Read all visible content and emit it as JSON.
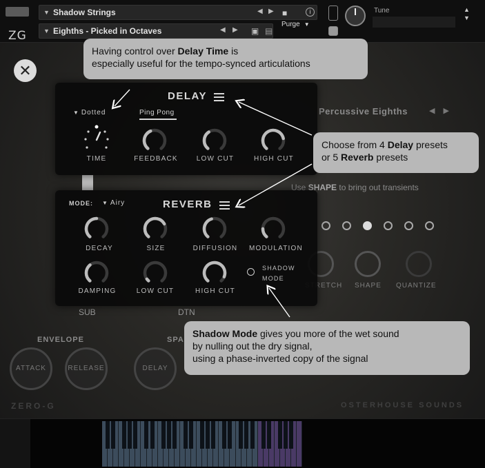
{
  "topbar": {
    "logo": "ZG",
    "preset_name": "Shadow Strings",
    "articulation_name": "Eighths - Picked in Octaves",
    "purge_label": "Purge",
    "tune_label": "Tune"
  },
  "background": {
    "right_panel_title": "Percussive Eighths",
    "shape_hint_pre": "Use",
    "shape_hint_word": "SHAPE",
    "shape_hint_post": "to bring out transients",
    "right_knobs": [
      "STRETCH",
      "SHAPE",
      "QUANTIZE"
    ],
    "sub_label": "SUB",
    "dtn_label": "DTN",
    "envelope_label": "ENVELOPE",
    "space_label": "SPACE",
    "attack_label": "ATTACK",
    "release_label": "RELEASE",
    "delay_label": "DELAY",
    "brand_left": "ZERO-G",
    "brand_right": "OSTERHOUSE SOUNDS"
  },
  "delay": {
    "title": "DELAY",
    "mode_value": "Dotted",
    "ping_pong": "Ping Pong",
    "knobs": [
      {
        "label": "TIME"
      },
      {
        "label": "FEEDBACK",
        "value": 0.42
      },
      {
        "label": "LOW CUT",
        "value": 0.38
      },
      {
        "label": "HIGH CUT",
        "value": 0.78
      }
    ]
  },
  "reverb": {
    "title": "REVERB",
    "mode_label": "MODE:",
    "mode_value": "Airy",
    "knobs_row1": [
      {
        "label": "DECAY",
        "value": 0.5
      },
      {
        "label": "SIZE",
        "value": 0.72
      },
      {
        "label": "DIFFUSION",
        "value": 0.44
      },
      {
        "label": "MODULATION",
        "value": 0.18
      }
    ],
    "knobs_row2": [
      {
        "label": "DAMPING",
        "value": 0.36
      },
      {
        "label": "LOW CUT",
        "value": 0.05
      },
      {
        "label": "HIGH CUT",
        "value": 0.9
      }
    ],
    "shadow_mode": "SHADOW MODE"
  },
  "tooltips": {
    "tip1_line1_pre": "Having control over ",
    "tip1_line1_bold": "Delay Time",
    "tip1_line1_post": " is",
    "tip1_line2": "especially useful for the tempo-synced articulations",
    "tip2_pre": "Choose from 4 ",
    "tip2_bold1": "Delay",
    "tip2_mid": " presets",
    "tip2_line2_pre": "or 5 ",
    "tip2_bold2": "Reverb",
    "tip2_post": " presets",
    "tip3_bold": "Shadow Mode",
    "tip3_line1": " gives you more of the wet sound",
    "tip3_line2": "by nulling out the dry signal,",
    "tip3_line3": "using a phase-inverted copy of the signal"
  },
  "colors": {
    "panel_bg": "#0a0a0a",
    "tooltip_bg": "#b8b8b8",
    "text_light": "#d8d8d8",
    "knob_track": "#3a3a3a",
    "knob_fill": "#bcbcbc"
  }
}
